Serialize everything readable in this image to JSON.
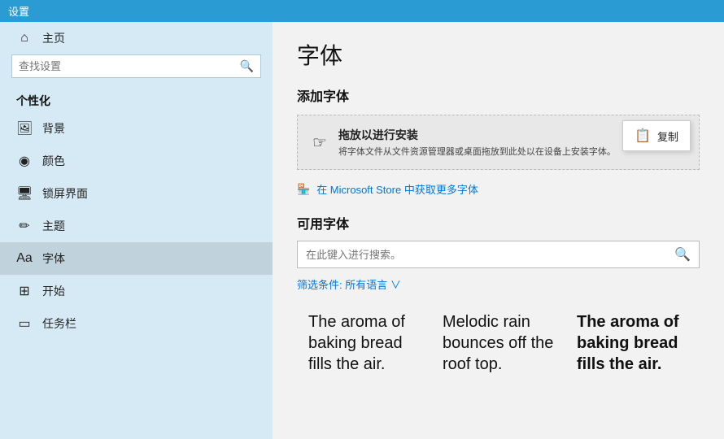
{
  "titlebar": {
    "label": "设置"
  },
  "sidebar": {
    "home_label": "主页",
    "search_placeholder": "查找设置",
    "group_title": "个性化",
    "items": [
      {
        "id": "background",
        "icon": "🖼",
        "label": "背景"
      },
      {
        "id": "color",
        "icon": "🎨",
        "label": "颜色"
      },
      {
        "id": "lockscreen",
        "icon": "🖥",
        "label": "锁屏界面"
      },
      {
        "id": "theme",
        "icon": "🖌",
        "label": "主题"
      },
      {
        "id": "font",
        "icon": "Aa",
        "label": "字体",
        "active": true
      },
      {
        "id": "start",
        "icon": "⊞",
        "label": "开始"
      },
      {
        "id": "taskbar",
        "icon": "▭",
        "label": "任务栏"
      }
    ]
  },
  "content": {
    "page_title": "字体",
    "add_font_heading": "添加字体",
    "drop_zone": {
      "title": "拖放以进行安装",
      "subtitle": "将字体文件从文件资源管理器或桌面拖放到此处以在设备上安装字体。"
    },
    "tooltip": {
      "label": "复制"
    },
    "store_link": "在 Microsoft Store 中获取更多字体",
    "available_heading": "可用字体",
    "font_search_placeholder": "在此键入进行搜索。",
    "filter_label": "筛选条件:",
    "filter_value": "所有语言",
    "font_previews": [
      {
        "text": "The aroma of baking bread fills the air.",
        "style": "normal"
      },
      {
        "text": "Melodic rain bounces off the roof top.",
        "style": "normal"
      },
      {
        "text": "The aroma of baking bread fills the air.",
        "style": "bold"
      }
    ]
  }
}
